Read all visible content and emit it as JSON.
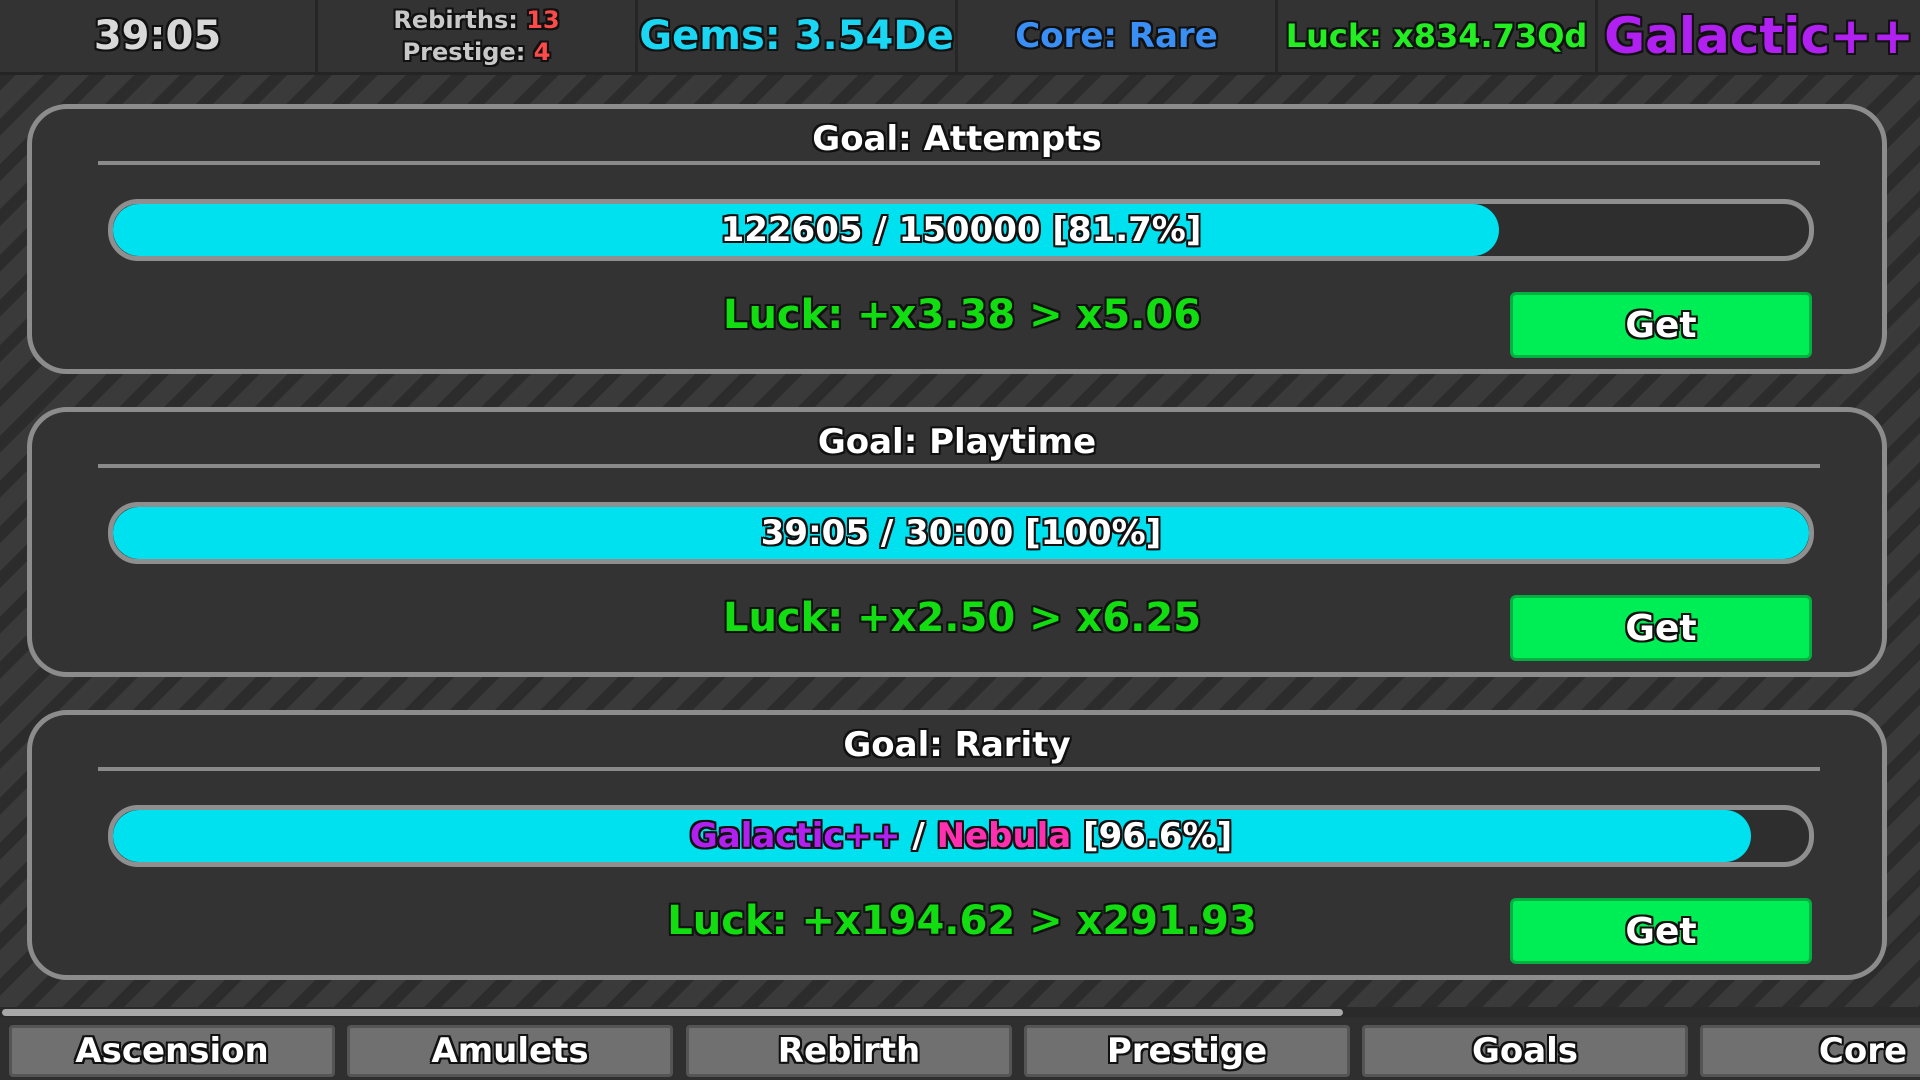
{
  "stats": {
    "time": "39:05",
    "rebirths_label": "Rebirths:",
    "rebirths_value": "13",
    "prestige_label": "Prestige:",
    "prestige_value": "4",
    "gems": "Gems: 3.54De",
    "core": "Core: Rare",
    "luck": "Luck: x834.73Qd",
    "rarity": "Galactic++"
  },
  "goals": [
    {
      "title": "Goal: Attempts",
      "progress_text": "122605 / 150000 [81.7%]",
      "progress_fraction": 0.817,
      "luck": "Luck: +x3.38 > x5.06",
      "button": "Get"
    },
    {
      "title": "Goal: Playtime",
      "progress_text": "39:05 / 30:00 [100%]",
      "progress_fraction": 1.0,
      "luck": "Luck: +x2.50 > x6.25",
      "button": "Get"
    },
    {
      "title": "Goal: Rarity",
      "progress_current": "Galactic++",
      "progress_sep": " / ",
      "progress_target": "Nebula",
      "progress_pct": " [96.6%]",
      "progress_fraction": 0.966,
      "luck": "Luck: +x194.62 > x291.93",
      "button": "Get"
    }
  ],
  "tabs": [
    "Ascension",
    "Amulets",
    "Rebirth",
    "Prestige",
    "Goals",
    "Core"
  ],
  "scroll_fraction": 0.7,
  "colors": {
    "progress_fill": "#00e1f0",
    "get_button": "#00ee55",
    "luck_text": "#11dd11",
    "gems": "#1ad6f2",
    "core": "#3a8ff7",
    "rarity_galactic": "#b020f0",
    "rarity_nebula": "#ff30b0"
  }
}
